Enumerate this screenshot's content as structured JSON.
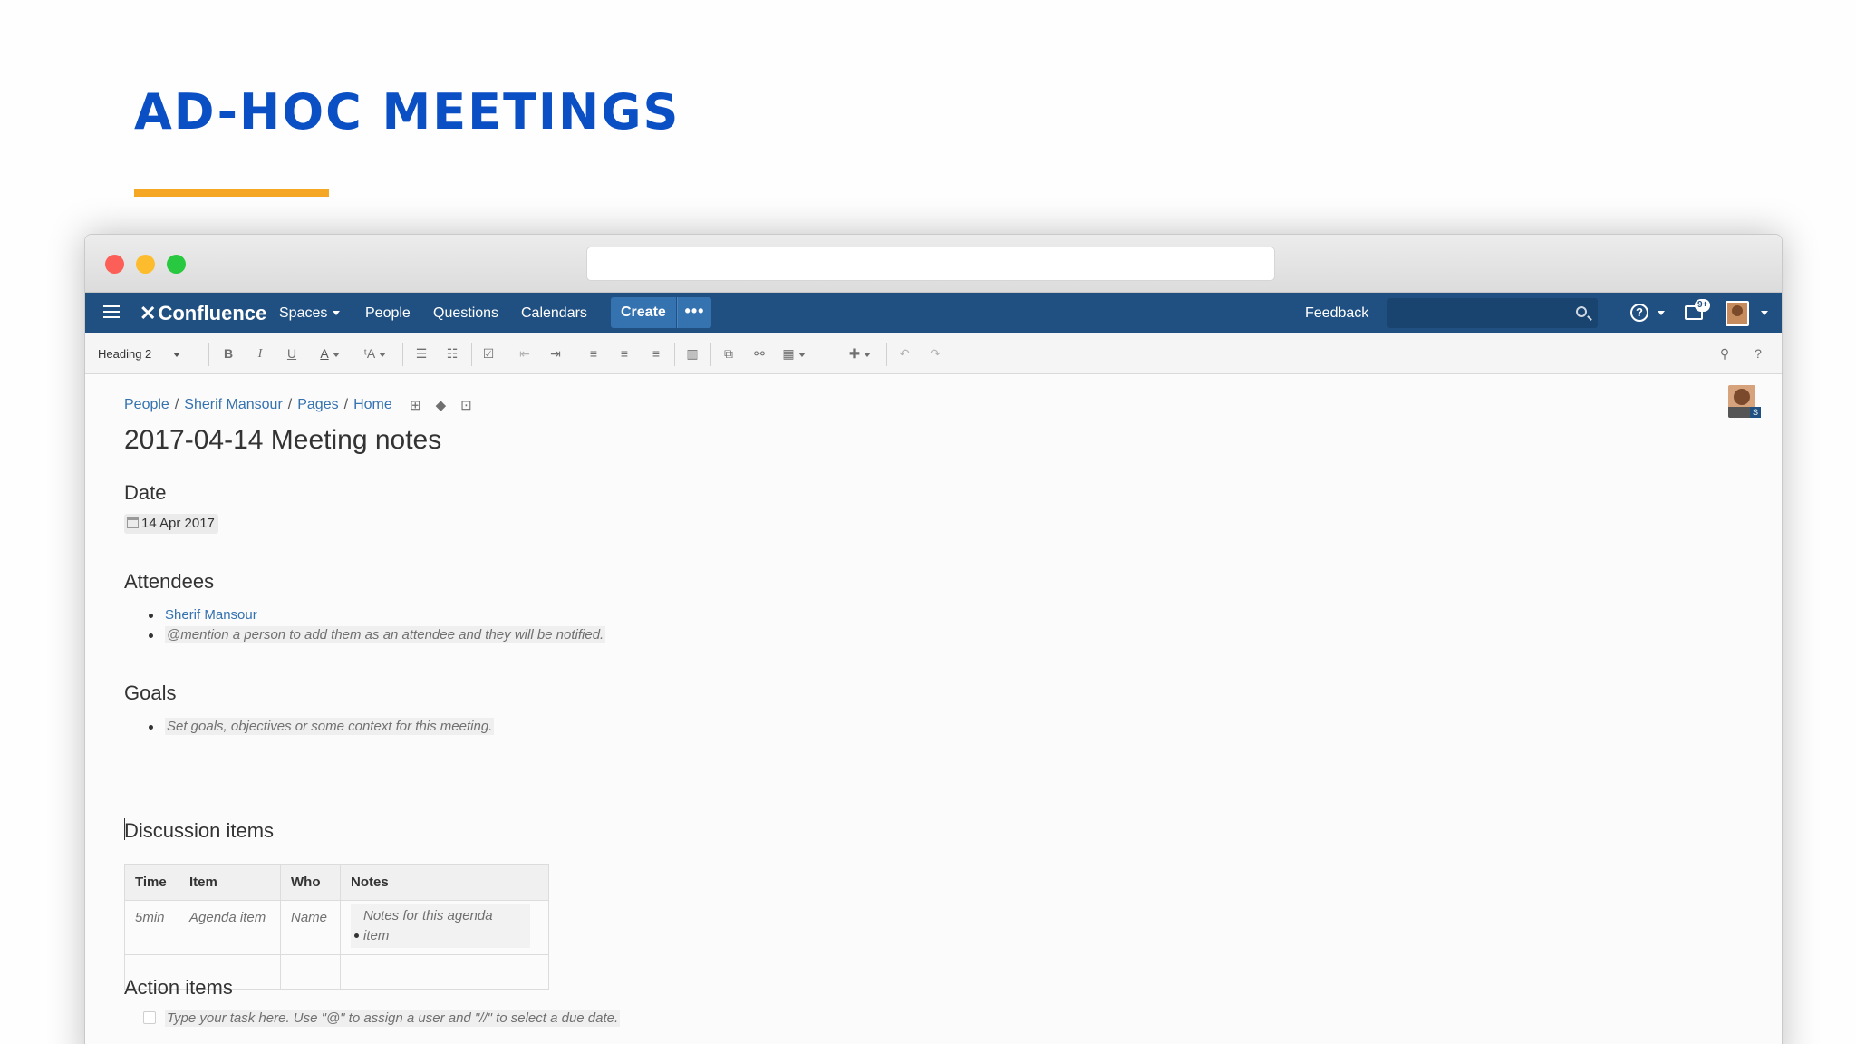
{
  "slide": {
    "title": "AD-HOC MEETINGS"
  },
  "nav": {
    "logo": "Confluence",
    "spaces": "Spaces",
    "people": "People",
    "questions": "Questions",
    "calendars": "Calendars",
    "create": "Create",
    "more": "•••",
    "feedback": "Feedback",
    "notif_badge": "9+",
    "help_glyph": "?"
  },
  "toolbar": {
    "paragraph_style": "Heading 2",
    "bold": "B",
    "italic": "I",
    "underline": "U",
    "text_color": "A",
    "formatting": "ᵗA",
    "help": "?"
  },
  "page": {
    "breadcrumb": [
      "People",
      "Sherif Mansour",
      "Pages",
      "Home"
    ],
    "title": "2017-04-14 Meeting notes",
    "avatar_badge": "S",
    "date_heading": "Date",
    "date_value": "14 Apr 2017",
    "attendees_heading": "Attendees",
    "attendees": [
      "Sherif Mansour",
      "@mention a person to add them as an attendee and they will be notified."
    ],
    "goals_heading": "Goals",
    "goals": [
      "Set goals, objectives or some context for this meeting."
    ],
    "discussion_heading": "Discussion items",
    "table": {
      "headers": [
        "Time",
        "Item",
        "Who",
        "Notes"
      ],
      "row": {
        "time": "5min",
        "item": "Agenda item",
        "who": "Name",
        "notes_line1": "Notes for this agenda",
        "notes_line2": "item"
      }
    },
    "action_heading": "Action items",
    "action_placeholder": "Type your task here. Use \"@\" to assign a user and \"//\" to select a due date."
  }
}
